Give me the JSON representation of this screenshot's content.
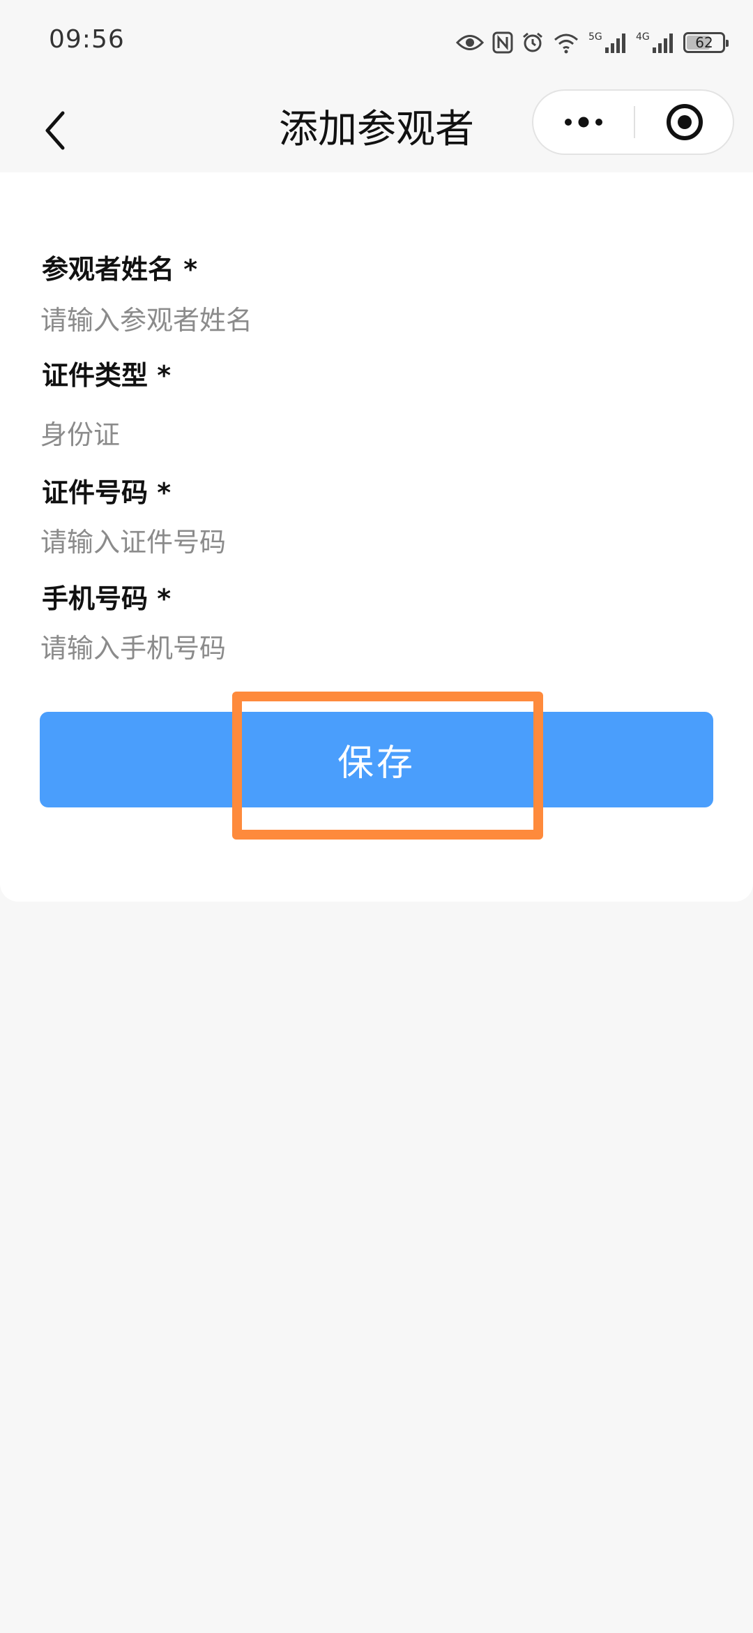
{
  "status_bar": {
    "time": "09:56",
    "signal_1_label": "5G",
    "signal_2_label": "4G",
    "battery_percent": "62",
    "icons": [
      "eye-icon",
      "nfc-icon",
      "alarm-icon",
      "wifi-icon",
      "signal-icon",
      "battery-icon"
    ]
  },
  "nav": {
    "title": "添加参观者",
    "back_icon": "chevron-left-icon",
    "more_icon": "more-dots-icon",
    "close_icon": "target-close-icon"
  },
  "form": {
    "name": {
      "label": "参观者姓名 *",
      "placeholder": "请输入参观者姓名"
    },
    "id_type": {
      "label": "证件类型 *",
      "value": "身份证"
    },
    "id_number": {
      "label": "证件号码 *",
      "placeholder": "请输入证件号码"
    },
    "phone": {
      "label": "手机号码 *",
      "placeholder": "请输入手机号码"
    },
    "save_label": "保存"
  },
  "colors": {
    "primary": "#4a9efc",
    "highlight": "#fe8a3c",
    "background": "#f7f7f7",
    "card": "#ffffff"
  }
}
